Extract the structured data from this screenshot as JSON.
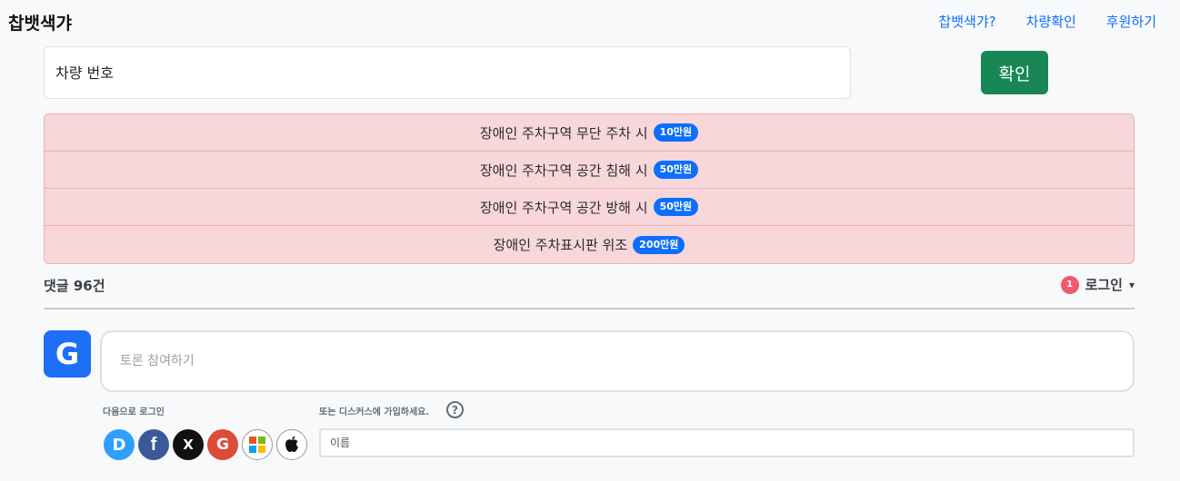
{
  "header": {
    "brand": "찹뱃색갸",
    "nav": [
      "찹뱃색갸?",
      "차량확인",
      "후원하기"
    ]
  },
  "search": {
    "placeholder": "차량 번호",
    "button_label": "확인"
  },
  "fines": [
    {
      "text": "장애인 주차구역 무단 주차 시",
      "amount": "10만원"
    },
    {
      "text": "장애인 주차구역 공간 침해 시",
      "amount": "50만원"
    },
    {
      "text": "장애인 주차구역 공간 방해 시",
      "amount": "50만원"
    },
    {
      "text": "장애인 주차표시판 위조",
      "amount": "200만원"
    }
  ],
  "comments": {
    "count_label": "댓글 96건",
    "notification_count": "1",
    "login_label": "로그인",
    "caret": "▾",
    "avatar_letter": "G",
    "discuss_placeholder": "토론 참여하기",
    "login_with": "다음으로 로그인",
    "or_signup": "또는 디스커스에 가입하세요.",
    "help": "?",
    "name_placeholder": "이름",
    "social": [
      {
        "name": "disqus",
        "glyph": "D",
        "color": "#2e9fff"
      },
      {
        "name": "facebook",
        "glyph": "f",
        "color": "#3b5998"
      },
      {
        "name": "x",
        "glyph": "X",
        "color": "#111111"
      },
      {
        "name": "google",
        "glyph": "G",
        "color": "#dd4b39"
      },
      {
        "name": "microsoft",
        "glyph": "",
        "color": "#ffffff"
      },
      {
        "name": "apple",
        "glyph": "",
        "color": "#ffffff"
      }
    ]
  }
}
